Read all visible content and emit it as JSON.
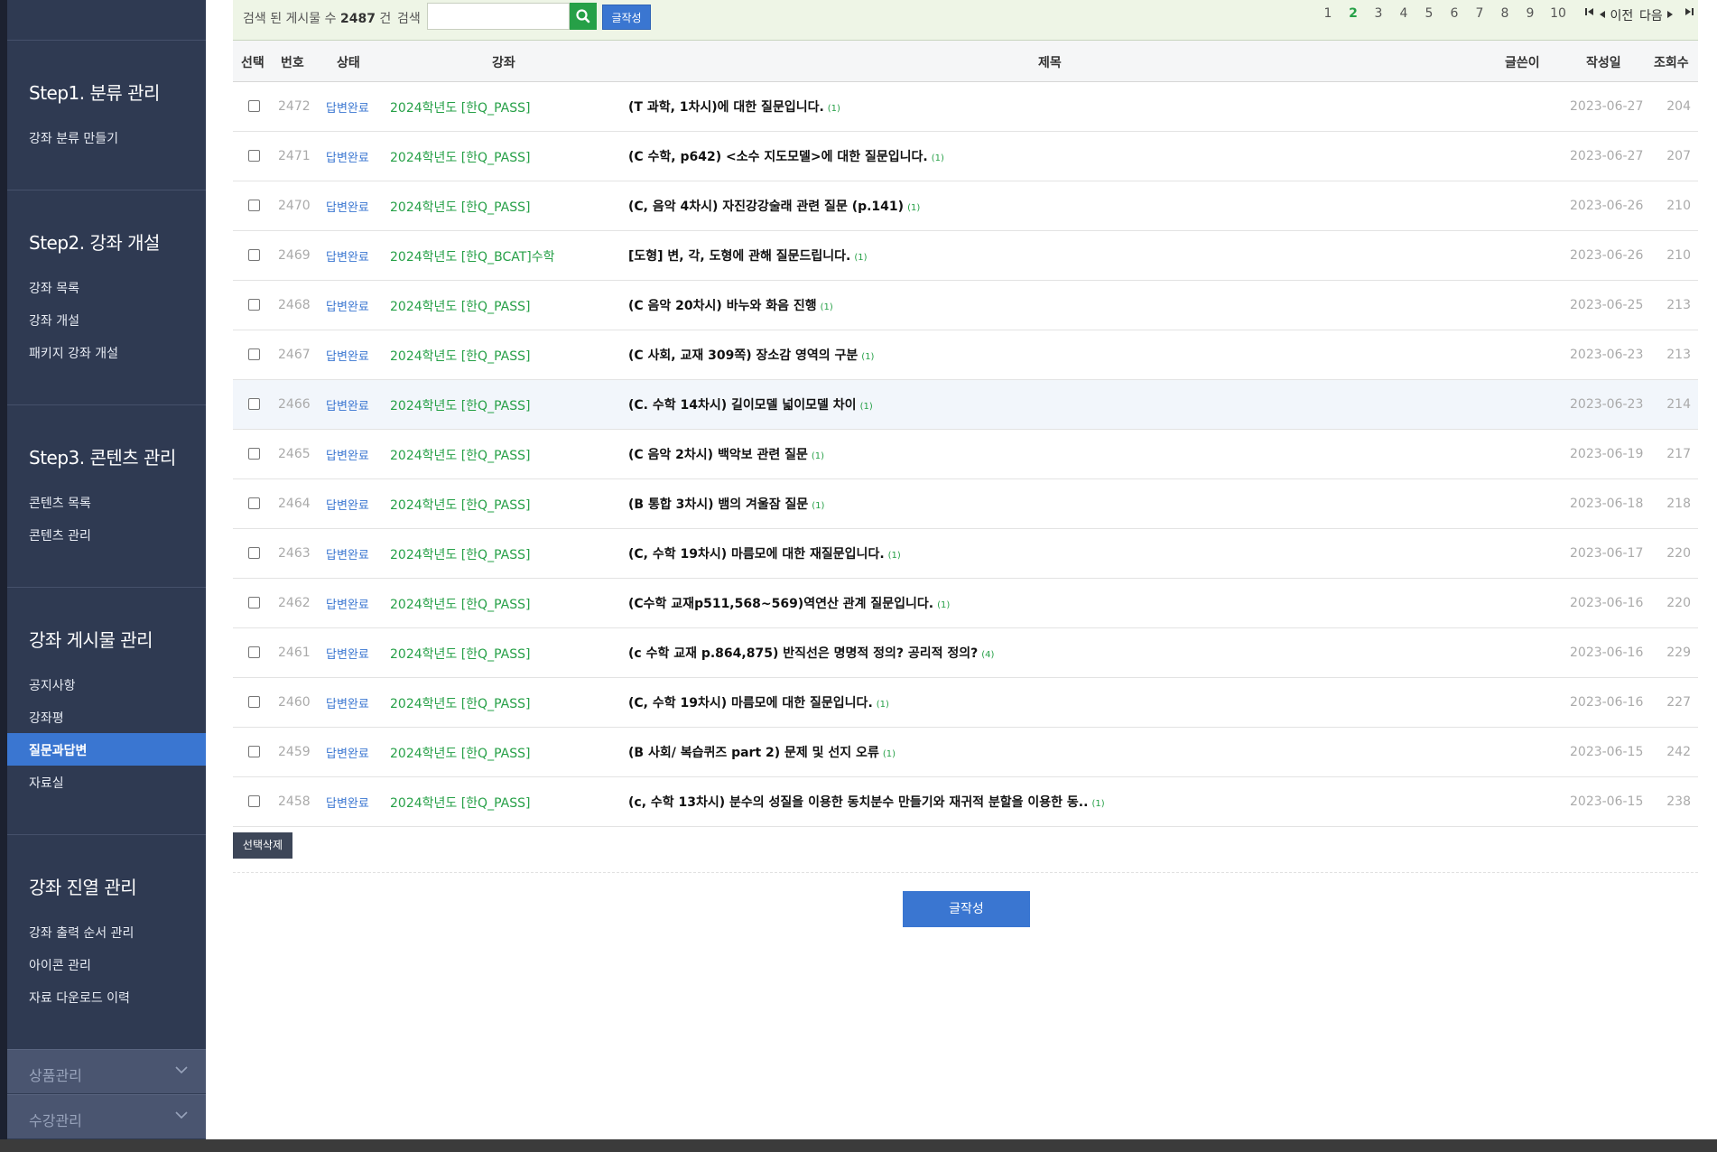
{
  "sidebar": {
    "sections": [
      {
        "title": "Step1. 분류 관리",
        "items": [
          "강좌 분류 만들기"
        ]
      },
      {
        "title": "Step2. 강좌 개설",
        "items": [
          "강좌 목록",
          "강좌 개설",
          "패키지 강좌 개설"
        ]
      },
      {
        "title": "Step3. 콘텐츠 관리",
        "items": [
          "콘텐츠 목록",
          "콘텐츠 관리"
        ]
      },
      {
        "title": "강좌 게시물 관리",
        "items": [
          "공지사항",
          "강좌평",
          "질문과답변",
          "자료실"
        ],
        "active_index": 2
      },
      {
        "title": "강좌 진열 관리",
        "items": [
          "강좌 출력 순서 관리",
          "아이콘 관리",
          "자료 다운로드 이력"
        ]
      }
    ],
    "collapsibles": [
      "상품관리",
      "수강관리"
    ]
  },
  "search_bar": {
    "count_prefix": "검색 된 게시물 수",
    "count_value": "2487",
    "count_suffix": "건",
    "search_label": "검색",
    "search_value": "",
    "write_label": "글작성"
  },
  "pagination": {
    "pages": [
      "1",
      "2",
      "3",
      "4",
      "5",
      "6",
      "7",
      "8",
      "9",
      "10"
    ],
    "current": "2",
    "prev_label": "이전",
    "next_label": "다음"
  },
  "table": {
    "headers": {
      "select": "선택",
      "number": "번호",
      "status": "상태",
      "course": "강좌",
      "title": "제목",
      "author": "글쓴이",
      "date": "작성일",
      "views": "조회수"
    },
    "rows": [
      {
        "num": "2472",
        "status": "답변완료",
        "course": "2024학년도 [한Q_PASS]",
        "title": "(T 과학, 1차시)에 대한 질문입니다.",
        "comments": "(1)",
        "author": "",
        "date": "2023-06-27",
        "views": "204"
      },
      {
        "num": "2471",
        "status": "답변완료",
        "course": "2024학년도 [한Q_PASS]",
        "title": "(C 수학, p642) <소수 지도모델>에 대한 질문입니다.",
        "comments": "(1)",
        "author": "",
        "date": "2023-06-27",
        "views": "207"
      },
      {
        "num": "2470",
        "status": "답변완료",
        "course": "2024학년도 [한Q_PASS]",
        "title": "(C, 음악 4차시) 자진강강술래 관련 질문 (p.141)",
        "comments": "(1)",
        "author": "",
        "date": "2023-06-26",
        "views": "210"
      },
      {
        "num": "2469",
        "status": "답변완료",
        "course": "2024학년도 [한Q_BCAT]수학",
        "title": "[도형] 변, 각, 도형에 관해 질문드립니다.",
        "comments": "(1)",
        "author": "",
        "date": "2023-06-26",
        "views": "210"
      },
      {
        "num": "2468",
        "status": "답변완료",
        "course": "2024학년도 [한Q_PASS]",
        "title": "(C 음악 20차시) 바누와 화음 진행",
        "comments": "(1)",
        "author": "",
        "date": "2023-06-25",
        "views": "213"
      },
      {
        "num": "2467",
        "status": "답변완료",
        "course": "2024학년도 [한Q_PASS]",
        "title": "(C 사회, 교재 309쪽) 장소감 영역의 구분",
        "comments": "(1)",
        "author": "",
        "date": "2023-06-23",
        "views": "213"
      },
      {
        "num": "2466",
        "status": "답변완료",
        "course": "2024학년도 [한Q_PASS]",
        "title": "(C. 수학 14차시) 길이모델 넓이모델 차이",
        "comments": "(1)",
        "author": "",
        "date": "2023-06-23",
        "views": "214",
        "highlight": true
      },
      {
        "num": "2465",
        "status": "답변완료",
        "course": "2024학년도 [한Q_PASS]",
        "title": "(C 음악 2차시) 백악보 관련 질문",
        "comments": "(1)",
        "author": "",
        "date": "2023-06-19",
        "views": "217"
      },
      {
        "num": "2464",
        "status": "답변완료",
        "course": "2024학년도 [한Q_PASS]",
        "title": "(B 통합 3차시) 뱀의 겨울잠 질문",
        "comments": "(1)",
        "author": "",
        "date": "2023-06-18",
        "views": "218"
      },
      {
        "num": "2463",
        "status": "답변완료",
        "course": "2024학년도 [한Q_PASS]",
        "title": "(C, 수학 19차시) 마름모에 대한 재질문입니다.",
        "comments": "(1)",
        "author": "",
        "date": "2023-06-17",
        "views": "220"
      },
      {
        "num": "2462",
        "status": "답변완료",
        "course": "2024학년도 [한Q_PASS]",
        "title": "(C수학 교재p511,568~569)역연산 관계 질문입니다.",
        "comments": "(1)",
        "author": "",
        "date": "2023-06-16",
        "views": "220"
      },
      {
        "num": "2461",
        "status": "답변완료",
        "course": "2024학년도 [한Q_PASS]",
        "title": "(c 수학 교재 p.864,875) 반직선은 명명적 정의? 공리적 정의?",
        "comments": "(4)",
        "author": "",
        "date": "2023-06-16",
        "views": "229"
      },
      {
        "num": "2460",
        "status": "답변완료",
        "course": "2024학년도 [한Q_PASS]",
        "title": "(C, 수학 19차시) 마름모에 대한 질문입니다.",
        "comments": "(1)",
        "author": "",
        "date": "2023-06-16",
        "views": "227"
      },
      {
        "num": "2459",
        "status": "답변완료",
        "course": "2024학년도 [한Q_PASS]",
        "title": "(B 사회/ 복습퀴즈 part 2) 문제 및 선지 오류",
        "comments": "(1)",
        "author": "",
        "date": "2023-06-15",
        "views": "242"
      },
      {
        "num": "2458",
        "status": "답변완료",
        "course": "2024학년도 [한Q_PASS]",
        "title": "(c, 수학 13차시) 분수의 성질을 이용한 동치분수 만들기와 재귀적 분할을 이용한 동..",
        "comments": "(1)",
        "author": "",
        "date": "2023-06-15",
        "views": "238"
      }
    ]
  },
  "actions": {
    "delete_selected": "선택삭제",
    "write": "글작성"
  },
  "colors": {
    "sidebar_bg": "#2f3a52",
    "accent_blue": "#3a76d1",
    "accent_green": "#26a047",
    "topbar_bg": "#eef5e6"
  }
}
